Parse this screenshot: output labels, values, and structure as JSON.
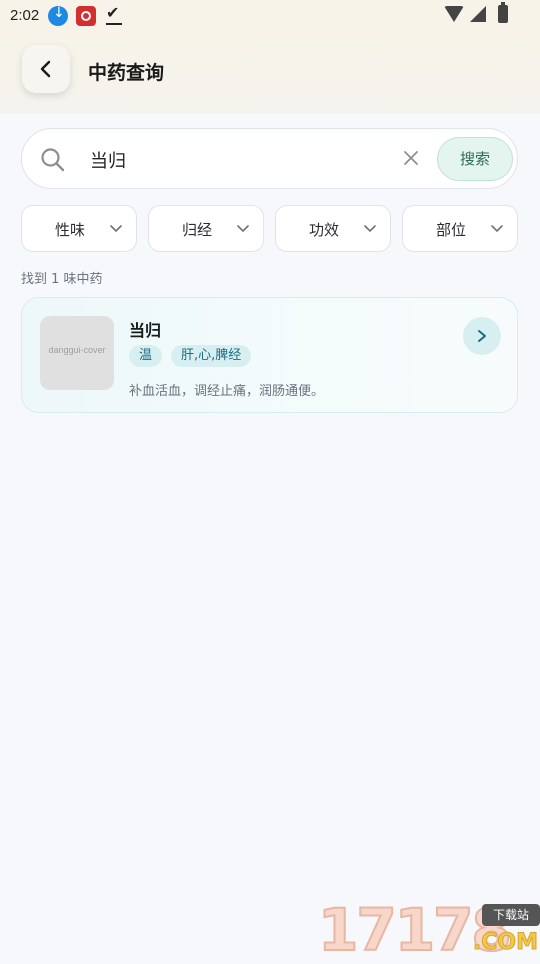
{
  "status_bar": {
    "time": "2:02"
  },
  "header": {
    "title": "中药查询"
  },
  "search": {
    "value": "当归",
    "button_label": "搜索"
  },
  "filters": [
    {
      "label": "性味"
    },
    {
      "label": "归经"
    },
    {
      "label": "功效"
    },
    {
      "label": "部位"
    }
  ],
  "results": {
    "count_text": "找到 1 味中药",
    "items": [
      {
        "name": "当归",
        "image_alt": "danggui-cover",
        "tags": [
          "温",
          "肝,心,脾经"
        ],
        "description": "补血活血，调经止痛，润肠通便。"
      }
    ]
  },
  "watermark": {
    "digits": "17178",
    "badge": "下载站",
    "domain": ".COM"
  },
  "icons": [
    "download-icon",
    "app-icon",
    "checkmark-icon",
    "wifi-icon",
    "signal-icon",
    "battery-icon",
    "back-arrow-icon",
    "search-icon",
    "clear-icon",
    "chevron-down-icon",
    "chevron-right-icon"
  ]
}
